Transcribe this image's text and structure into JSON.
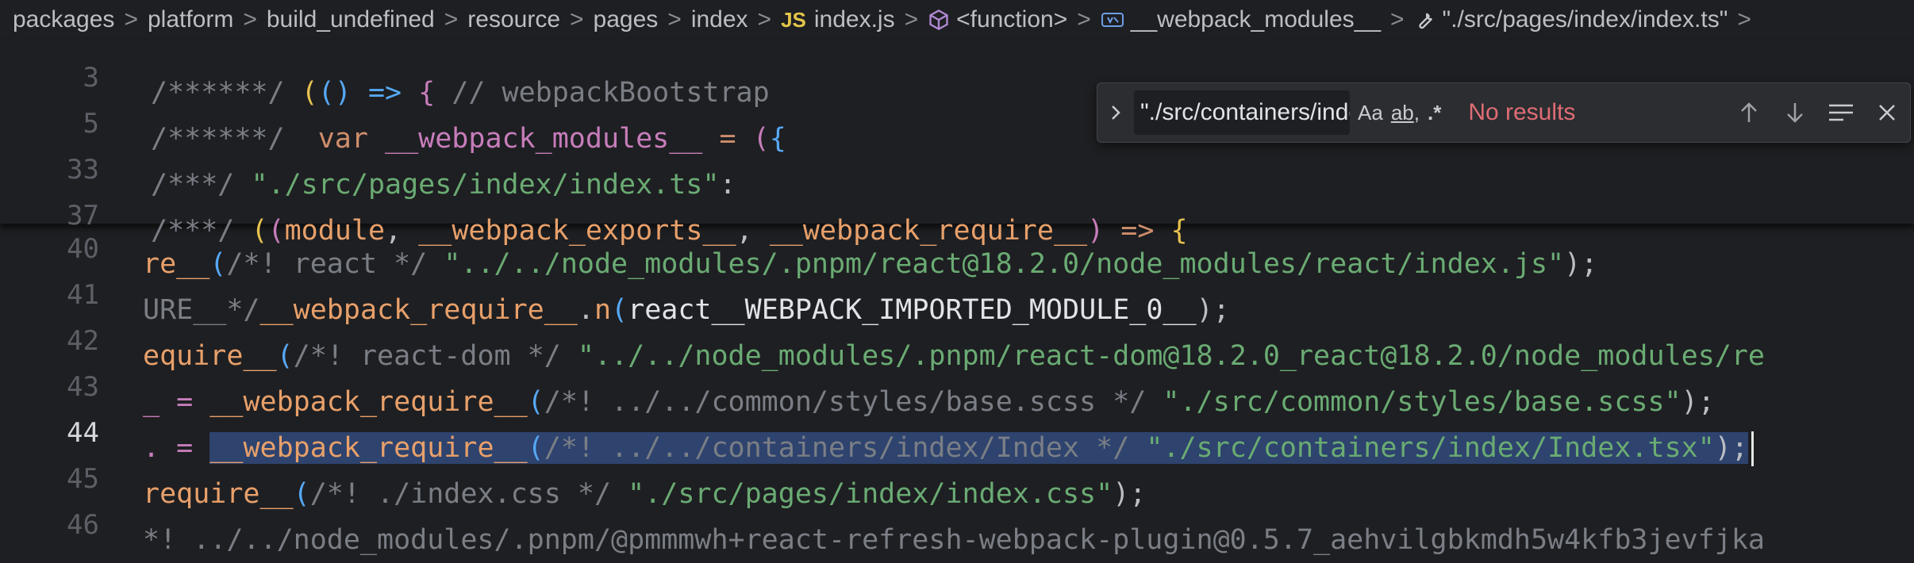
{
  "breadcrumb": {
    "items": [
      "packages",
      "platform",
      "build_undefined",
      "resource",
      "pages",
      "index",
      "index.js",
      "<function>",
      "__webpack_modules__",
      "\"./src/pages/index/index.ts\""
    ],
    "js_badge": "JS"
  },
  "find": {
    "query": "\"./src/containers/index/Index\"",
    "match_case": "Aa",
    "whole_word": "ab",
    "regex": ".*",
    "status": "No results"
  },
  "sticky_lines": [
    {
      "num": "3",
      "t": {
        "a": "/******/ ",
        "b": "(",
        "c": "() => ",
        "d": "{",
        "e": " // webpackBootstrap"
      }
    },
    {
      "num": "5",
      "t": {
        "a": "/******/  ",
        "b": "var ",
        "c": "__webpack_modules__",
        "d": " = ",
        "e": "(",
        "f": "{"
      }
    },
    {
      "num": "33",
      "t": {
        "a": "/***/ ",
        "b": "\"./src/pages/index/index.ts\"",
        "c": ":"
      }
    },
    {
      "num": "37",
      "t": {
        "a": "/***/ ",
        "b": "(",
        "c": "(",
        "d": "module",
        "e": ", ",
        "f": "__webpack_exports__",
        "g": ", ",
        "h": "__webpack_require__",
        "i": ")",
        "j": " => ",
        "k": "{"
      }
    }
  ],
  "lines": [
    {
      "num": "40",
      "t": {
        "a": "re__",
        "b": "(",
        "c": "/*! react */ ",
        "d": "\"../../node_modules/.pnpm/react@18.2.0/node_modules/react/index.js\"",
        "e": ");"
      }
    },
    {
      "num": "41",
      "t": {
        "a": "URE__*/",
        "b": "__webpack_require__",
        "c": ".",
        "d": "n",
        "e": "(",
        "f": "react__WEBPACK_IMPORTED_MODULE_0__",
        "g": ");"
      }
    },
    {
      "num": "42",
      "t": {
        "a": "equire__",
        "b": "(",
        "c": "/*! react-dom */ ",
        "d": "\"../../node_modules/.pnpm/react-dom@18.2.0_react@18.2.0/node_modules/re"
      }
    },
    {
      "num": "43",
      "t": {
        "a": "_ = ",
        "b": "__webpack_require__",
        "c": "(",
        "d": "/*! ../../common/styles/base.scss */ ",
        "e": "\"./src/common/styles/base.scss\"",
        "f": ");"
      }
    },
    {
      "num": "44",
      "t": {
        "a": ". = ",
        "b": "__webpack_require__",
        "c": "(",
        "d": "/*! ../../containers/index/Index */ ",
        "e": "\"./src/containers/index/Index.tsx\"",
        "f": ");"
      }
    },
    {
      "num": "45",
      "t": {
        "a": "require__",
        "b": "(",
        "c": "/*! ./index.css */ ",
        "d": "\"./src/pages/index/index.css\"",
        "e": ");"
      }
    },
    {
      "num": "46",
      "t": {
        "a": "*! ../../node_modules/.pnpm/@pmmmwh+react-refresh-webpack-plugin@0.5.7_aehvilgbkmdh5w4kfb3jevfjka"
      }
    }
  ],
  "colors": {
    "background": "#1e1f22",
    "selection": "#2e436e",
    "no_results": "#e06c75",
    "string": "#6aab73",
    "function": "#e8a06a"
  }
}
